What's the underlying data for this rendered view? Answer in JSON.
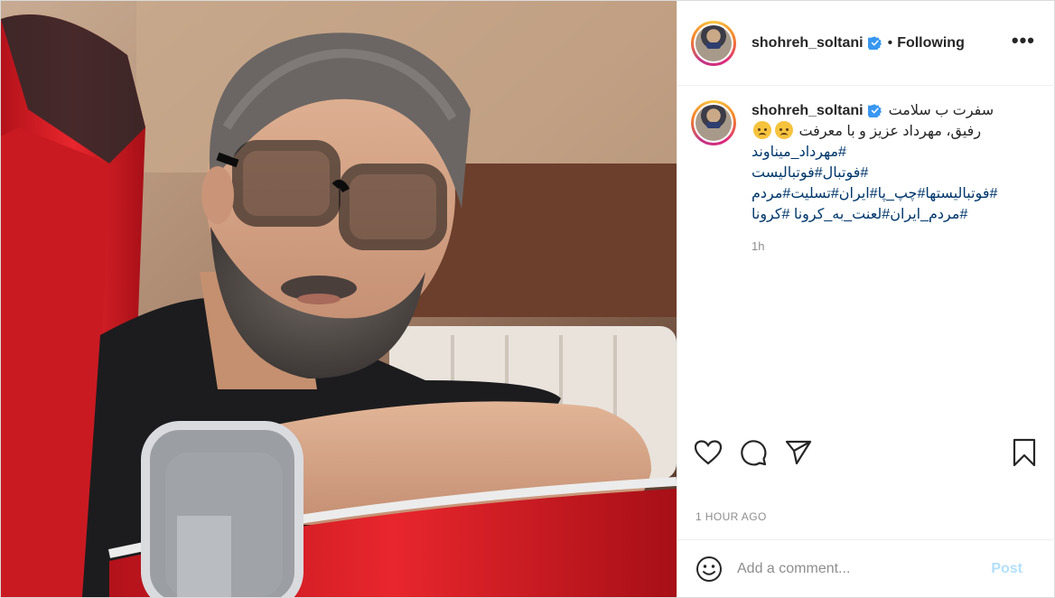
{
  "post": {
    "photo_alt": "",
    "header": {
      "username": "shohreh_soltani",
      "separator": "•",
      "follow_state": "Following",
      "more_label": "•••"
    },
    "caption": {
      "username": "shohreh_soltani",
      "line1": "سفرت ب سلامت",
      "line2": "رفیق، مهرداد عزیز و با معرفت",
      "line3": "#مهرداد_میناوند",
      "line4": "#فوتبال#فوتبالیست",
      "line5": "#فوتبالیستها#چپ_پا#ایران#تسلیت#مردم",
      "line6": "#مردم_ایران#لعنت_به_کرونا #کرونا",
      "relative_time": "1h"
    },
    "actions": {
      "like": "heart-icon",
      "comment": "comment-icon",
      "share": "share-icon",
      "save": "bookmark-icon"
    },
    "timestamp": "1 hour ago",
    "comment_box": {
      "placeholder": "Add a comment...",
      "post_label": "Post"
    },
    "colors": {
      "link": "#00376b",
      "verified": "#3897f0",
      "post_button_disabled": "#b2dffc",
      "muted": "#8e8e8e"
    }
  }
}
